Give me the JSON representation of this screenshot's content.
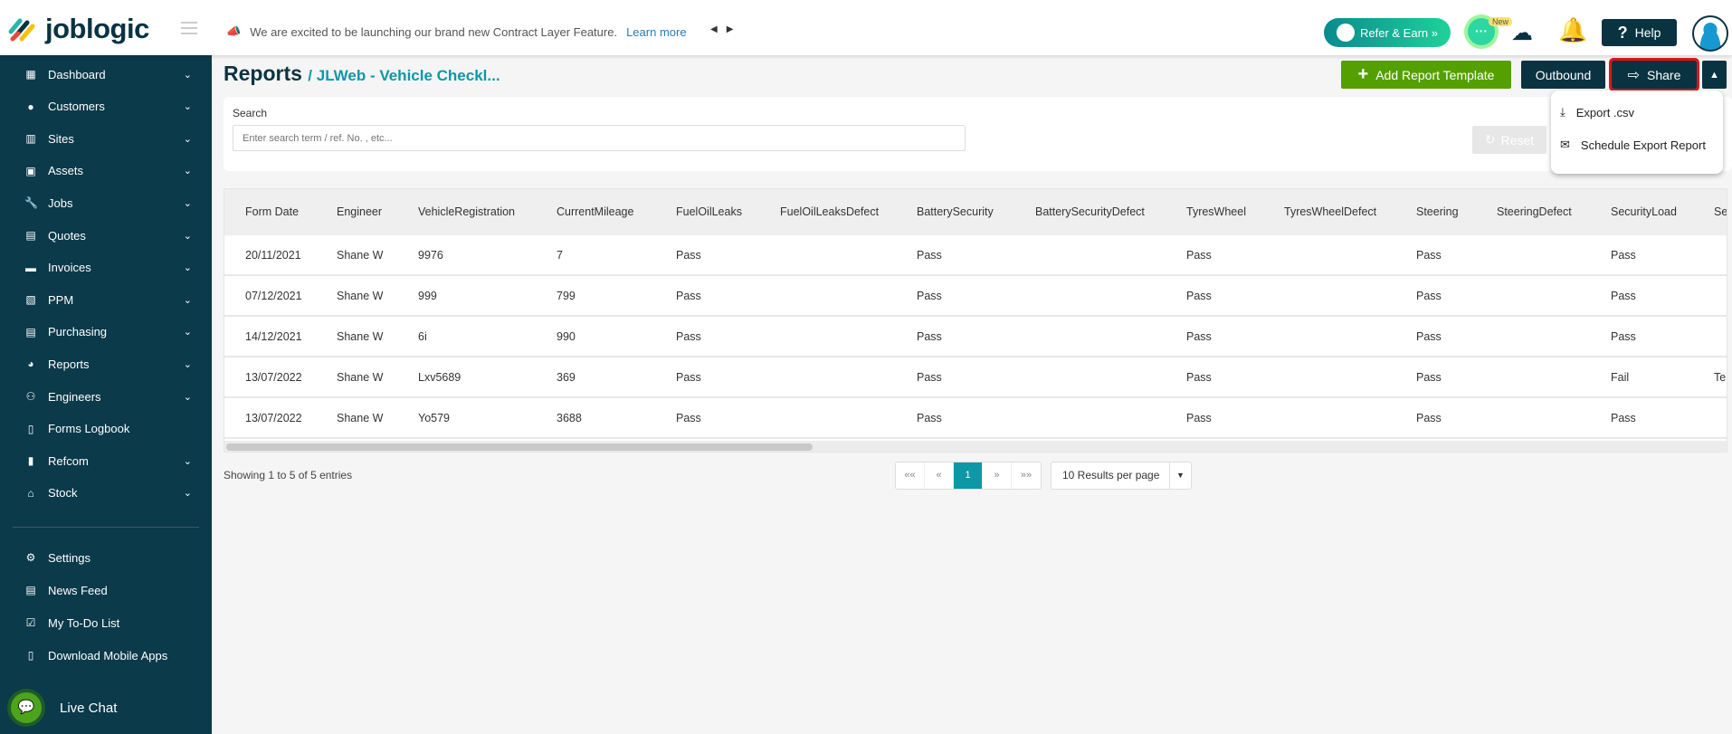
{
  "brand": {
    "name": "joblogic"
  },
  "announcement": {
    "text": "We are excited to be launching our brand new Contract Layer Feature.",
    "link": "Learn more"
  },
  "header": {
    "refer_label": "Refer & Earn »",
    "new_badge": "New",
    "help_label": "Help"
  },
  "sidebar": {
    "items": [
      {
        "label": "Dashboard",
        "icon": "dashboard-icon",
        "chev": true
      },
      {
        "label": "Customers",
        "icon": "person-icon",
        "chev": true
      },
      {
        "label": "Sites",
        "icon": "building-icon",
        "chev": true
      },
      {
        "label": "Assets",
        "icon": "asset-icon",
        "chev": true
      },
      {
        "label": "Jobs",
        "icon": "wrench-icon",
        "chev": true
      },
      {
        "label": "Quotes",
        "icon": "clipboard-icon",
        "chev": true
      },
      {
        "label": "Invoices",
        "icon": "card-icon",
        "chev": true
      },
      {
        "label": "PPM",
        "icon": "ppm-icon",
        "chev": true
      },
      {
        "label": "Purchasing",
        "icon": "document-icon",
        "chev": true
      },
      {
        "label": "Reports",
        "icon": "pie-chart-icon",
        "chev": true
      },
      {
        "label": "Engineers",
        "icon": "people-icon",
        "chev": true
      },
      {
        "label": "Forms Logbook",
        "icon": "book-icon",
        "chev": false
      },
      {
        "label": "Refcom",
        "icon": "cylinder-icon",
        "chev": true
      },
      {
        "label": "Stock",
        "icon": "warehouse-icon",
        "chev": true
      }
    ],
    "bottom": [
      {
        "label": "Settings",
        "icon": "user-gear-icon"
      },
      {
        "label": "News Feed",
        "icon": "newspaper-icon"
      },
      {
        "label": "My To-Do List",
        "icon": "checklist-icon"
      },
      {
        "label": "Download Mobile Apps",
        "icon": "phone-icon"
      }
    ],
    "live_chat": "Live Chat"
  },
  "page": {
    "title": "Reports",
    "breadcrumb": "/ JLWeb - Vehicle Checkl..."
  },
  "toolbar": {
    "add_label": "Add Report Template",
    "outbound_label": "Outbound",
    "share_label": "Share"
  },
  "share_menu": {
    "items": [
      {
        "label": "Export .csv",
        "icon": "download-icon"
      },
      {
        "label": "Schedule Export Report",
        "icon": "envelope-icon"
      }
    ]
  },
  "search": {
    "label": "Search",
    "placeholder": "Enter search term / ref. No. , etc...",
    "reset_label": "Reset"
  },
  "table": {
    "columns": [
      "Form Date",
      "Engineer",
      "VehicleRegistration",
      "CurrentMileage",
      "FuelOilLeaks",
      "FuelOilLeaksDefect",
      "BatterySecurity",
      "BatterySecurityDefect",
      "TyresWheel",
      "TyresWheelDefect",
      "Steering",
      "SteeringDefect",
      "SecurityLoad",
      "Se"
    ],
    "rows": [
      [
        "20/11/2021",
        "Shane W",
        "9976",
        "7",
        "Pass",
        "",
        "Pass",
        "",
        "Pass",
        "",
        "Pass",
        "",
        "Pass",
        ""
      ],
      [
        "07/12/2021",
        "Shane W",
        "999",
        "799",
        "Pass",
        "",
        "Pass",
        "",
        "Pass",
        "",
        "Pass",
        "",
        "Pass",
        ""
      ],
      [
        "14/12/2021",
        "Shane W",
        "6i",
        "990",
        "Pass",
        "",
        "Pass",
        "",
        "Pass",
        "",
        "Pass",
        "",
        "Pass",
        ""
      ],
      [
        "13/07/2022",
        "Shane W",
        "Lxv5689",
        "369",
        "Pass",
        "",
        "Pass",
        "",
        "Pass",
        "",
        "Pass",
        "",
        "Fail",
        "Te"
      ],
      [
        "13/07/2022",
        "Shane W",
        "Yo579",
        "3688",
        "Pass",
        "",
        "Pass",
        "",
        "Pass",
        "",
        "Pass",
        "",
        "Pass",
        ""
      ]
    ]
  },
  "footer": {
    "showing": "Showing 1 to 5 of 5 entries",
    "pages": [
      "««",
      "«",
      "1",
      "»",
      "»»"
    ],
    "current_page": "1",
    "per_page": "10 Results per page"
  },
  "colors": {
    "sidebar": "#0b3a4a",
    "accent": "#0c98a6",
    "add_button": "#54a000",
    "highlight": "#e0141e"
  }
}
